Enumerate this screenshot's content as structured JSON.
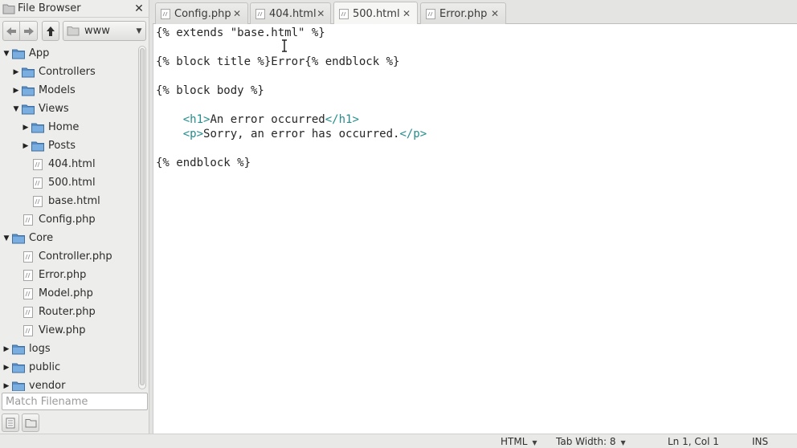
{
  "file_browser": {
    "title": "File Browser",
    "close_glyph": "✕",
    "path_combo": "www",
    "filter_placeholder": "Match Filename",
    "tree": [
      {
        "label": "App",
        "type": "folder",
        "expanded": true,
        "level": 0
      },
      {
        "label": "Controllers",
        "type": "folder",
        "expanded": false,
        "level": 1
      },
      {
        "label": "Models",
        "type": "folder",
        "expanded": false,
        "level": 1
      },
      {
        "label": "Views",
        "type": "folder",
        "expanded": true,
        "level": 1
      },
      {
        "label": "Home",
        "type": "folder",
        "expanded": false,
        "level": 2
      },
      {
        "label": "Posts",
        "type": "folder",
        "expanded": false,
        "level": 2
      },
      {
        "label": "404.html",
        "type": "file",
        "level": 2
      },
      {
        "label": "500.html",
        "type": "file",
        "level": 2
      },
      {
        "label": "base.html",
        "type": "file",
        "level": 2
      },
      {
        "label": "Config.php",
        "type": "file",
        "level": 1
      },
      {
        "label": "Core",
        "type": "folder",
        "expanded": true,
        "level": 0
      },
      {
        "label": "Controller.php",
        "type": "file",
        "level": 1
      },
      {
        "label": "Error.php",
        "type": "file",
        "level": 1
      },
      {
        "label": "Model.php",
        "type": "file",
        "level": 1
      },
      {
        "label": "Router.php",
        "type": "file",
        "level": 1
      },
      {
        "label": "View.php",
        "type": "file",
        "level": 1
      },
      {
        "label": "logs",
        "type": "folder",
        "expanded": false,
        "level": 0
      },
      {
        "label": "public",
        "type": "folder",
        "expanded": false,
        "level": 0
      },
      {
        "label": "vendor",
        "type": "folder",
        "expanded": false,
        "level": 0
      }
    ]
  },
  "tabs": [
    {
      "label": "Config.php",
      "active": false,
      "close_glyph": "✕"
    },
    {
      "label": "404.html",
      "active": false,
      "close_glyph": "✕"
    },
    {
      "label": "500.html",
      "active": true,
      "close_glyph": "✕"
    },
    {
      "label": "Error.php",
      "active": false,
      "close_glyph": "✕"
    }
  ],
  "editor": {
    "lines": [
      [
        {
          "t": "{% extends \"base.html\" %}",
          "c": "plain"
        }
      ],
      [],
      [
        {
          "t": "{% block title %}Error{% endblock %}",
          "c": "plain"
        }
      ],
      [],
      [
        {
          "t": "{% block body %}",
          "c": "plain"
        }
      ],
      [],
      [
        {
          "t": "    ",
          "c": "plain"
        },
        {
          "t": "<h1>",
          "c": "tag"
        },
        {
          "t": "An error occurred",
          "c": "plain"
        },
        {
          "t": "</h1>",
          "c": "tag"
        }
      ],
      [
        {
          "t": "    ",
          "c": "plain"
        },
        {
          "t": "<p>",
          "c": "tag"
        },
        {
          "t": "Sorry, an error has occurred.",
          "c": "plain"
        },
        {
          "t": "</p>",
          "c": "tag"
        }
      ],
      [],
      [
        {
          "t": "{% endblock %}",
          "c": "plain"
        }
      ]
    ]
  },
  "statusbar": {
    "language": "HTML",
    "tab_width": "Tab Width: 8",
    "position": "Ln 1, Col 1",
    "mode": "INS"
  },
  "colors": {
    "tag": "#238d8d",
    "folder": "#5b8fc7",
    "editor_bg": "#ffffff"
  }
}
